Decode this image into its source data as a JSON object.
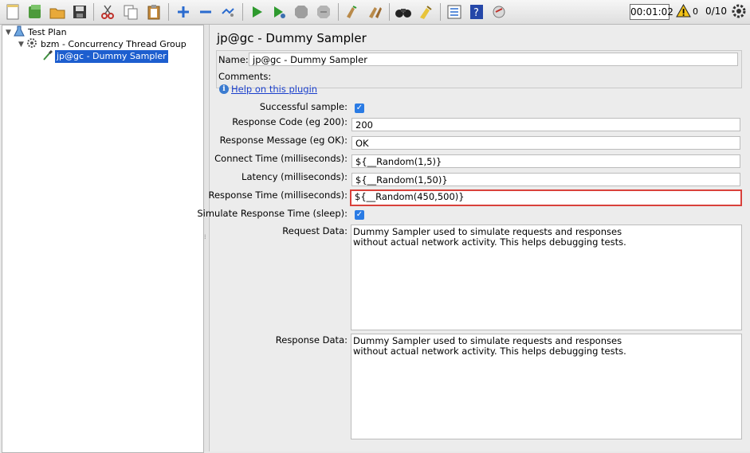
{
  "toolbar": {
    "items": [
      "new-icon",
      "templates-icon",
      "open-icon",
      "save-icon",
      "cut-icon",
      "copy-icon",
      "paste-icon",
      "expand-icon",
      "collapse-icon",
      "toggle-icon",
      "start-icon",
      "start-no-pauses-icon",
      "stop-icon",
      "shutdown-icon",
      "clear-icon",
      "clear-all-icon",
      "search-icon",
      "reset-search-icon",
      "function-helper-icon",
      "help-icon",
      "remote-icon"
    ],
    "timer": "00:01:02",
    "warning_count": "0",
    "threads": "0/10"
  },
  "tree": {
    "items": [
      {
        "label": "Test Plan",
        "icon": "flask-icon"
      },
      {
        "label": "bzm - Concurrency Thread Group",
        "icon": "gear-icon"
      },
      {
        "label": "jp@gc - Dummy Sampler",
        "icon": "pipette-icon",
        "selected": true
      }
    ]
  },
  "panel": {
    "title": "jp@gc - Dummy Sampler",
    "name_label": "Name:",
    "name_value": "jp@gc - Dummy Sampler",
    "comments_label": "Comments:",
    "help_link": "Help on this plugin",
    "successful_label": "Successful sample:",
    "successful_checked": true,
    "response_code_label": "Response Code (eg 200):",
    "response_code_value": "200",
    "response_message_label": "Response Message (eg OK):",
    "response_message_value": "OK",
    "connect_time_label": "Connect Time (milliseconds):",
    "connect_time_value": "${__Random(1,5)}",
    "latency_label": "Latency (milliseconds):",
    "latency_value": "${__Random(1,50)}",
    "response_time_label": "Response Time (milliseconds):",
    "response_time_value": "${__Random(450,500)}",
    "simulate_label": "Simulate Response Time (sleep):",
    "simulate_checked": true,
    "request_data_label": "Request Data:",
    "request_data_value": "Dummy Sampler used to simulate requests and responses\nwithout actual network activity. This helps debugging tests.",
    "response_data_label": "Response Data:",
    "response_data_value": "Dummy Sampler used to simulate requests and responses\nwithout actual network activity. This helps debugging tests."
  },
  "colors": {
    "selection": "#1d5ecf",
    "highlight_border": "#d9413b",
    "checkbox": "#2a7be4",
    "link": "#1a3fcc"
  }
}
